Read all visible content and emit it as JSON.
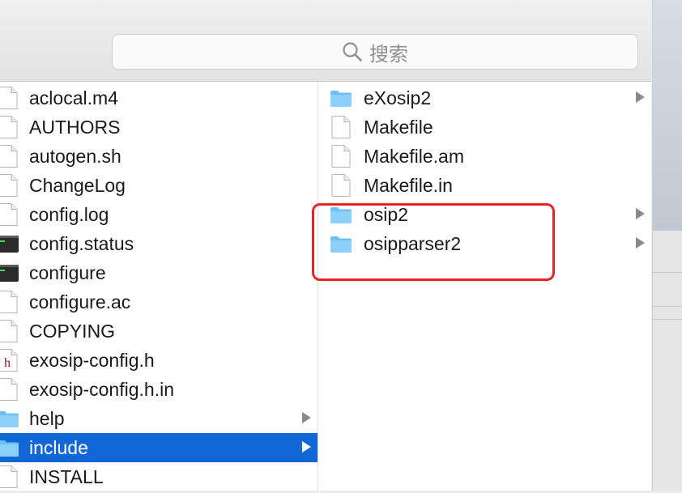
{
  "search": {
    "placeholder": "搜索"
  },
  "left_column": {
    "items": [
      {
        "label": "aclocal.m4",
        "icon": "document-icon",
        "has_arrow": false,
        "selected": false
      },
      {
        "label": "AUTHORS",
        "icon": "document-icon",
        "has_arrow": false,
        "selected": false
      },
      {
        "label": "autogen.sh",
        "icon": "document-icon",
        "has_arrow": false,
        "selected": false
      },
      {
        "label": "ChangeLog",
        "icon": "document-icon",
        "has_arrow": false,
        "selected": false
      },
      {
        "label": "config.log",
        "icon": "document-icon",
        "has_arrow": false,
        "selected": false
      },
      {
        "label": "config.status",
        "icon": "terminal-icon",
        "has_arrow": false,
        "selected": false
      },
      {
        "label": "configure",
        "icon": "terminal-icon",
        "has_arrow": false,
        "selected": false
      },
      {
        "label": "configure.ac",
        "icon": "document-icon",
        "has_arrow": false,
        "selected": false
      },
      {
        "label": "COPYING",
        "icon": "document-icon",
        "has_arrow": false,
        "selected": false
      },
      {
        "label": "exosip-config.h",
        "icon": "header-file-icon",
        "has_arrow": false,
        "selected": false
      },
      {
        "label": "exosip-config.h.in",
        "icon": "document-icon",
        "has_arrow": false,
        "selected": false
      },
      {
        "label": "help",
        "icon": "folder-icon",
        "has_arrow": true,
        "selected": false
      },
      {
        "label": "include",
        "icon": "folder-icon",
        "has_arrow": true,
        "selected": true
      },
      {
        "label": "INSTALL",
        "icon": "document-icon",
        "has_arrow": false,
        "selected": false
      }
    ]
  },
  "right_column": {
    "items": [
      {
        "label": "eXosip2",
        "icon": "folder-icon",
        "has_arrow": true
      },
      {
        "label": "Makefile",
        "icon": "document-icon",
        "has_arrow": false
      },
      {
        "label": "Makefile.am",
        "icon": "document-icon",
        "has_arrow": false
      },
      {
        "label": "Makefile.in",
        "icon": "document-icon",
        "has_arrow": false
      },
      {
        "label": "osip2",
        "icon": "folder-icon",
        "has_arrow": true
      },
      {
        "label": "osipparser2",
        "icon": "folder-icon",
        "has_arrow": true
      }
    ]
  },
  "header_file_glyph": "h",
  "colors": {
    "selection": "#1267d6",
    "folder": "#6cc0f2",
    "annotation": "#e5242a"
  }
}
